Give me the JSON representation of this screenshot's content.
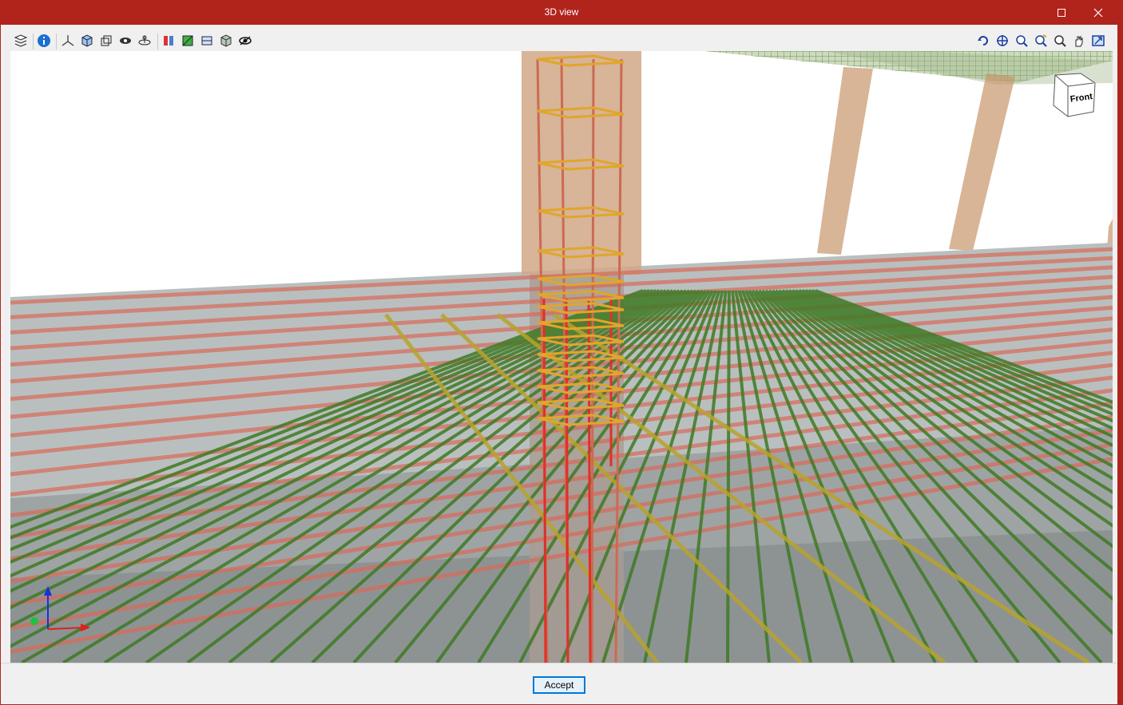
{
  "window": {
    "title": "3D view",
    "accent_color": "#b0241c",
    "maximize_icon": "maximize-icon",
    "close_icon": "close-icon"
  },
  "toolbar_left": [
    {
      "name": "layers-icon"
    },
    {
      "name": "info-icon"
    },
    {
      "name": "axes-icon"
    },
    {
      "name": "solid-view-icon"
    },
    {
      "name": "wireframe-view-icon"
    },
    {
      "name": "visibility-icon"
    },
    {
      "name": "orbit-icon"
    },
    {
      "name": "section-icon"
    },
    {
      "name": "clip-plane-icon"
    },
    {
      "name": "plan-view-icon"
    },
    {
      "name": "iso-view-icon"
    },
    {
      "name": "eye-icon"
    }
  ],
  "toolbar_right": [
    {
      "name": "rotate-icon"
    },
    {
      "name": "pan-3d-icon"
    },
    {
      "name": "zoom-window-icon"
    },
    {
      "name": "zoom-all-icon"
    },
    {
      "name": "zoom-icon"
    },
    {
      "name": "hand-pan-icon"
    },
    {
      "name": "fit-view-icon"
    }
  ],
  "view_cube": {
    "face_label": "Front"
  },
  "footer": {
    "accept_label": "Accept"
  }
}
